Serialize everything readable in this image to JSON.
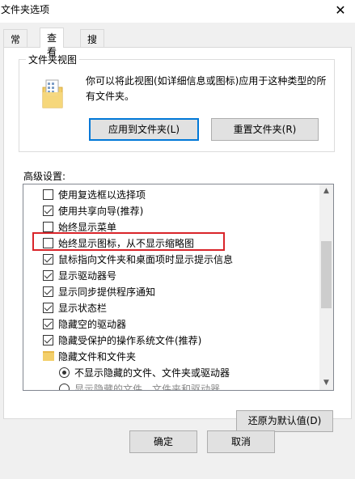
{
  "window": {
    "title": "文件夹选项",
    "close_glyph": "✕"
  },
  "tabs": [
    {
      "label": "常规",
      "active": false
    },
    {
      "label": "查看",
      "active": true
    },
    {
      "label": "搜索",
      "active": false
    }
  ],
  "folder_views": {
    "legend": "文件夹视图",
    "description": "你可以将此视图(如详细信息或图标)应用于这种类型的所有文件夹。",
    "apply_button": "应用到文件夹(L)",
    "reset_button": "重置文件夹(R)",
    "icon": "folder-icon"
  },
  "advanced": {
    "label": "高级设置:",
    "items": [
      {
        "type": "checkbox",
        "checked": false,
        "label": "使用复选框以选择项"
      },
      {
        "type": "checkbox",
        "checked": true,
        "label": "使用共享向导(推荐)"
      },
      {
        "type": "checkbox",
        "checked": false,
        "label": "始终显示菜单"
      },
      {
        "type": "checkbox",
        "checked": false,
        "label": "始终显示图标，从不显示缩略图"
      },
      {
        "type": "checkbox",
        "checked": true,
        "label": "鼠标指向文件夹和桌面项时显示提示信息"
      },
      {
        "type": "checkbox",
        "checked": true,
        "label": "显示驱动器号"
      },
      {
        "type": "checkbox",
        "checked": true,
        "label": "显示同步提供程序通知"
      },
      {
        "type": "checkbox",
        "checked": true,
        "label": "显示状态栏"
      },
      {
        "type": "checkbox",
        "checked": true,
        "label": "隐藏空的驱动器"
      },
      {
        "type": "checkbox",
        "checked": true,
        "label": "隐藏受保护的操作系统文件(推荐)"
      },
      {
        "type": "folder",
        "label": "隐藏文件和文件夹"
      },
      {
        "type": "radio",
        "checked": true,
        "label": "不显示隐藏的文件、文件夹或驱动器"
      },
      {
        "type": "radio",
        "checked": false,
        "label": "显示隐藏的文件、文件夹和驱动器"
      }
    ],
    "restore_button": "还原为默认值(D)"
  },
  "footer": {
    "ok_button": "确定",
    "cancel_button": "取消"
  },
  "colors": {
    "highlight_border": "#d9252a",
    "default_button_border": "#0078d7"
  }
}
